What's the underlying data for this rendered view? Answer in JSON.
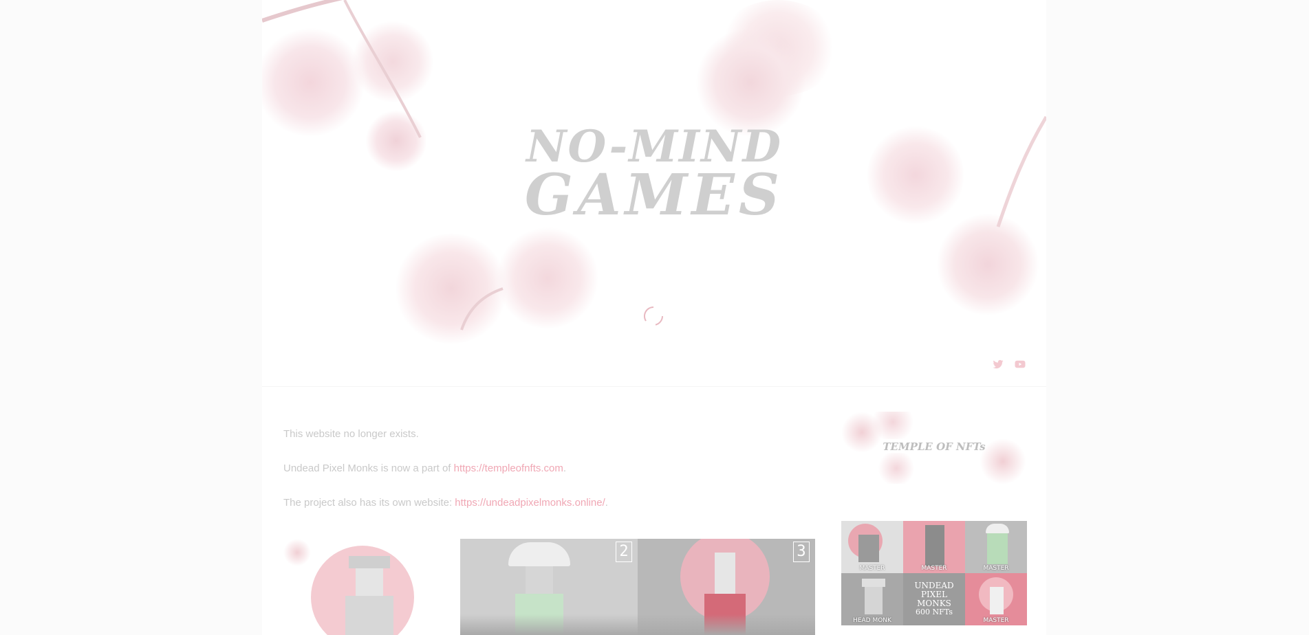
{
  "site": {
    "logo_line1": "NO-MIND",
    "logo_line2": "GAMES",
    "logo_alt": "No-Mind Games"
  },
  "nav": {
    "social": [
      {
        "icon": "twitter-icon"
      },
      {
        "icon": "youtube-icon"
      }
    ]
  },
  "content": {
    "line1": "This website no longer exists.",
    "line2_prefix": "Undead Pixel Monks is now a part of ",
    "line2_link": "https://templeofnfts.com",
    "line2_suffix": ".",
    "line3_prefix": "The project also has its own website: ",
    "line3_link": "https://undeadpixelmonks.online/",
    "line3_suffix": "."
  },
  "sidebar": {
    "banner_text": "TEMPLE OF NFTs",
    "grid": [
      {
        "label": "MASTER"
      },
      {
        "label": "MASTER"
      },
      {
        "label": "MASTER"
      },
      {
        "label": "HEAD MONK"
      },
      {
        "label": "UNDEAD PIXEL MONKS",
        "sublabel": "600 NFTs"
      },
      {
        "label": "MASTER"
      }
    ]
  },
  "thumbs": {
    "badge_2": "2",
    "badge_3": "3"
  },
  "colors": {
    "accent": "#f0a7b4",
    "logo": "#cfcfcf",
    "text": "#c9c9c9"
  }
}
